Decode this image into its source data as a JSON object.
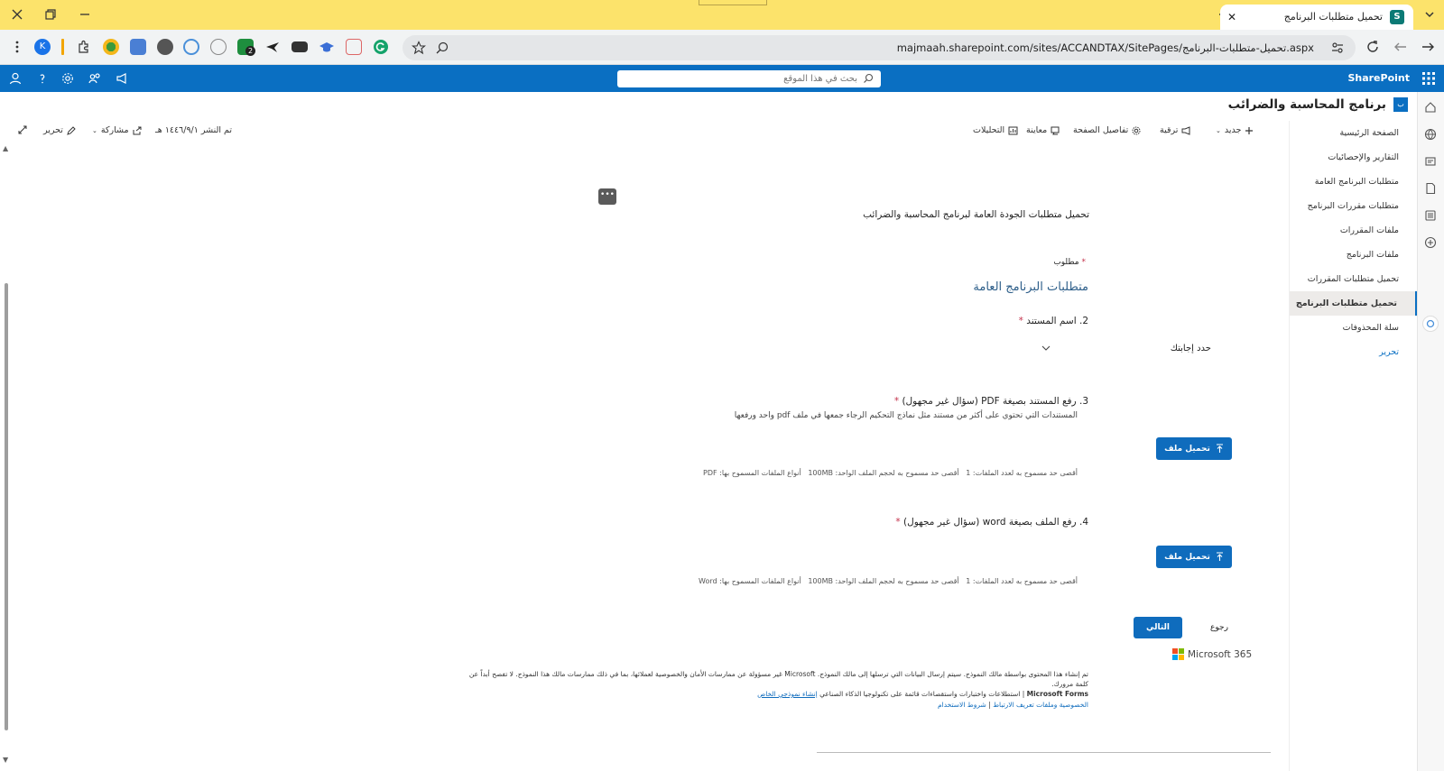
{
  "browser": {
    "tab_title": "تحميل متطلبات البرنامج",
    "url": "majmaah.sharepoint.com/sites/ACCANDTAX/SitePages/تحميل-متطلبات-البرنامج.aspx",
    "profile_initial": "K",
    "extension_badge": "2"
  },
  "suitebar": {
    "brand": "SharePoint",
    "search_placeholder": "بحث في هذا الموقع"
  },
  "site": {
    "title": "برنامج المحاسبة والضرائب"
  },
  "nav": {
    "items": [
      {
        "label": "الصفحة الرئيسية"
      },
      {
        "label": "التقارير والإحصائيات"
      },
      {
        "label": "متطلبات البرنامج العامة"
      },
      {
        "label": "متطلبات مقررات البرنامج"
      },
      {
        "label": "ملفات المقررات"
      },
      {
        "label": "ملفات البرنامج"
      },
      {
        "label": "تحميل متطلبات المقررات"
      },
      {
        "label": "تحميل متطلبات البرنامج"
      },
      {
        "label": "سلة المحذوفات"
      }
    ],
    "edit_label": "تحرير"
  },
  "commandbar": {
    "new": "جديد",
    "promote": "ترقية",
    "page_details": "تفاصيل الصفحة",
    "preview": "معاينة",
    "analytics": "التحليلات",
    "published": "تم النشر ١٤٤٦/٩/١ هـ",
    "share": "مشاركة",
    "edit": "تحرير"
  },
  "form": {
    "description": "تحميل متطلبات الجودة العامة لبرنامج المحاسبة والضرائب",
    "required_label": "مطلوب",
    "required_star": "*",
    "section_title": "متطلبات البرنامج العامة",
    "q2": {
      "label": "2. اسم المستند",
      "select_placeholder": "حدد إجابتك"
    },
    "q3": {
      "label": "3. رفع المستند بصيغة PDF (سؤال غير مجهول)",
      "hint": "المستندات التي تحتوي على أكثر من مستند مثل نماذج التحكيم الرجاء جمعها في ملف pdf واحد ورفعها",
      "upload_label": "تحميل ملف",
      "limit_count": "أقصى حد مسموح به لعدد الملفات: 1",
      "limit_size": "أقصى حد مسموح به لحجم الملف الواحد: 100MB",
      "limit_types": "أنواع الملفات المسموح بها: PDF"
    },
    "q4": {
      "label": "4. رفع  الملف بصيغة word (سؤال غير مجهول)",
      "upload_label": "تحميل ملف",
      "limit_count": "أقصى حد مسموح به لعدد الملفات: 1",
      "limit_size": "أقصى حد مسموح به لحجم الملف الواحد: 100MB",
      "limit_types": "أنواع الملفات المسموح بها: Word"
    },
    "next_label": "التالي",
    "back_label": "رجوع",
    "ms365_label": "Microsoft 365",
    "footer_disclaimer": "تم إنشاء هذا المحتوى بواسطة مالك النموذج. سيتم إرسال البيانات التي ترسلها إلى مالك النموذج. Microsoft غير مسؤولة عن ممارسات الأمان والخصوصية لعملائها، بما في ذلك ممارسات مالك هذا النموذج. لا تفصح أبداً عن كلمة مرورك.",
    "footer_forms_prefix": "Microsoft Forms",
    "footer_forms_text": " | استطلاعات واختبارات واستقصاءات قائمة على تكنولوجيا الذكاء الصناعي ",
    "footer_create_link": "إنشاء نموذجي الخاص",
    "footer_privacy": "الخصوصية وملفات تعريف الارتباط",
    "footer_terms": "شروط الاستخدام"
  },
  "colors": {
    "tabstrip": "#fce36b",
    "suitebar": "#0a6fc2",
    "primary_button": "#0f6cbd",
    "required": "#c4314b"
  }
}
